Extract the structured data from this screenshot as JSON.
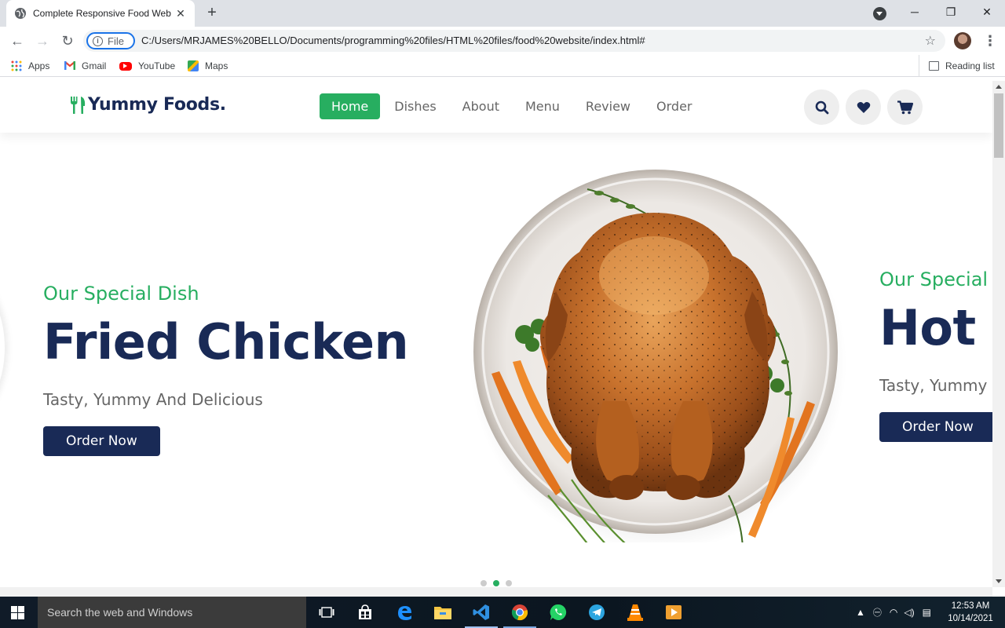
{
  "browser": {
    "tab_title": "Complete Responsive Food Web",
    "tab_close": "✕",
    "new_tab": "+",
    "window_controls": {
      "minimize": "─",
      "restore": "❐",
      "close": "✕"
    },
    "nav": {
      "back": "←",
      "forward": "→",
      "reload": "↻"
    },
    "site_chip": "File",
    "url": "C:/Users/MRJAMES%20BELLO/Documents/programming%20files/HTML%20files/food%20website/index.html#",
    "bookmark_star": "☆",
    "menu": "⋮",
    "bookmarks": [
      {
        "label": "Apps",
        "icon": "apps-grid-icon"
      },
      {
        "label": "Gmail",
        "icon": "gmail-icon"
      },
      {
        "label": "YouTube",
        "icon": "youtube-icon"
      },
      {
        "label": "Maps",
        "icon": "maps-icon"
      }
    ],
    "reading_list": "Reading list"
  },
  "site": {
    "logo_text": "Yummy Foods.",
    "logo_icon": "utensils-icon",
    "nav": [
      {
        "label": "Home",
        "active": true
      },
      {
        "label": "Dishes",
        "active": false
      },
      {
        "label": "About",
        "active": false
      },
      {
        "label": "Menu",
        "active": false
      },
      {
        "label": "Review",
        "active": false
      },
      {
        "label": "Order",
        "active": false
      }
    ],
    "header_icons": [
      "search-icon",
      "heart-icon",
      "shopping-cart-icon"
    ],
    "colors": {
      "green": "#27ae60",
      "navy": "#192a56",
      "gray": "#666666"
    }
  },
  "slides": [
    {
      "subhead": "Our Special Dish",
      "title": "Fried Chicken",
      "tagline": "Tasty, Yummy And Delicious",
      "button": "Order Now"
    },
    {
      "subhead": "Our Special D",
      "title": "Hot",
      "tagline": "Tasty, Yummy A",
      "button": "Order Now"
    }
  ],
  "slider_dots": {
    "count": 3,
    "active_index": 1
  },
  "taskbar": {
    "search_placeholder": "Search the web and Windows",
    "time": "12:53 AM",
    "date": "10/14/2021",
    "apps": [
      "task-view-icon",
      "store-icon",
      "edge-icon",
      "file-explorer-icon",
      "vscode-icon",
      "chrome-icon",
      "whatsapp-icon",
      "telegram-icon",
      "vlc-icon",
      "media-player-icon"
    ]
  }
}
